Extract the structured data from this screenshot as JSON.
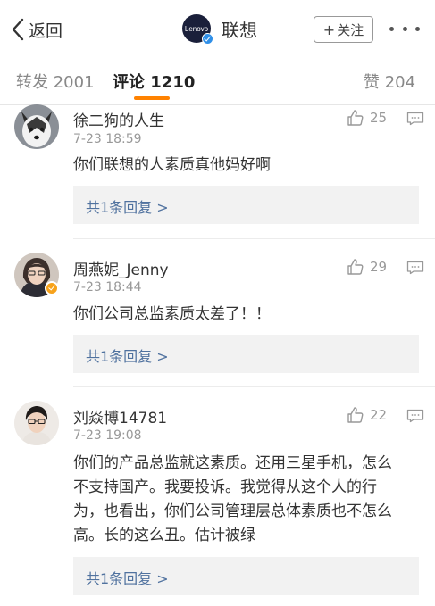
{
  "nav": {
    "back_label": "返回",
    "brand_logo_text": "Lenovo",
    "title": "联想",
    "follow_label": "关注"
  },
  "tabs": {
    "repost": "转发 2001",
    "comment": "评论 1210",
    "like": "赞 204"
  },
  "comments": [
    {
      "name": "徐二狗的人生",
      "time": "7-23 18:59",
      "text": "你们联想的人素质真他妈好啊",
      "likes": "25",
      "reply": "共1条回复 >"
    },
    {
      "name": "周燕妮_Jenny",
      "time": "7-23 18:44",
      "text": "你们公司总监素质太差了！！",
      "likes": "29",
      "reply": "共1条回复 >"
    },
    {
      "name": "刘焱博14781",
      "time": "7-23 19:08",
      "text": "你们的产品总监就这素质。还用三星手机，怎么不支持国产。我要投诉。我觉得从这个人的行为，也看出，你们公司管理层总体素质也不怎么高。长的这么丑。估计被绿",
      "likes": "22",
      "reply": "共1条回复 >"
    }
  ],
  "colors": {
    "accent": "#ff8200",
    "link": "#50729f",
    "verified_blue": "#2f8fe8",
    "verified_orange": "#f7a21b"
  }
}
